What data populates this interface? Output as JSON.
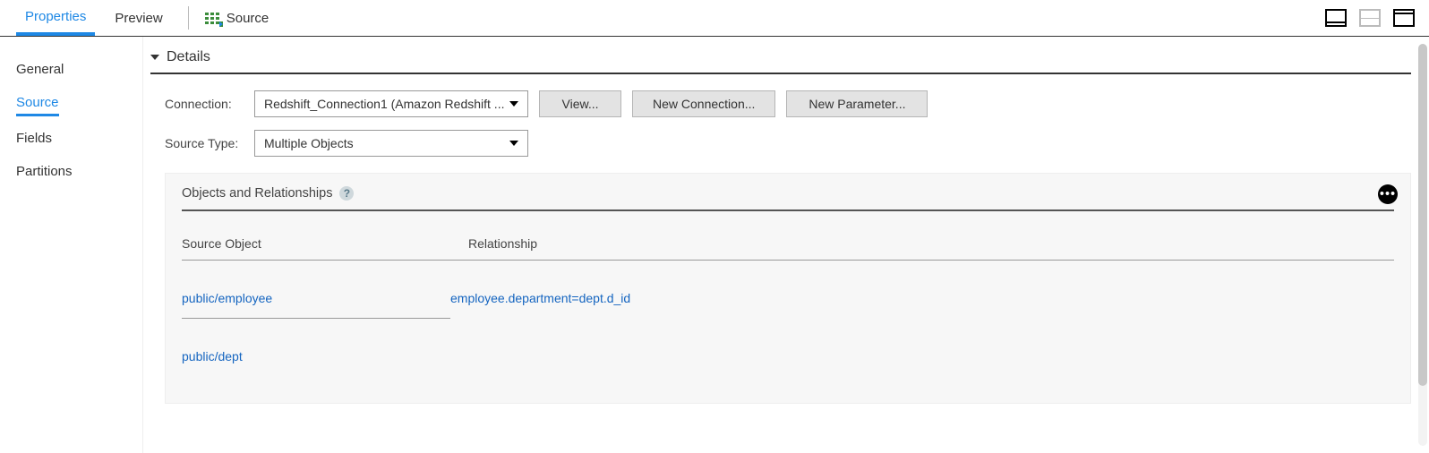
{
  "topbar": {
    "tabs": {
      "properties": "Properties",
      "preview": "Preview"
    },
    "source_chip": "Source"
  },
  "sidebar": {
    "items": [
      "General",
      "Source",
      "Fields",
      "Partitions"
    ],
    "active_index": 1
  },
  "details": {
    "title": "Details",
    "connection_label": "Connection:",
    "connection_value": "Redshift_Connection1 (Amazon Redshift ...",
    "source_type_label": "Source Type:",
    "source_type_value": "Multiple Objects",
    "buttons": {
      "view": "View...",
      "new_connection": "New Connection...",
      "new_parameter": "New Parameter..."
    }
  },
  "objects_panel": {
    "title": "Objects and Relationships",
    "columns": {
      "source_object": "Source Object",
      "relationship": "Relationship"
    },
    "rows": [
      {
        "source_object": "public/employee",
        "relationship": "employee.department=dept.d_id"
      },
      {
        "source_object": "public/dept",
        "relationship": ""
      }
    ]
  }
}
